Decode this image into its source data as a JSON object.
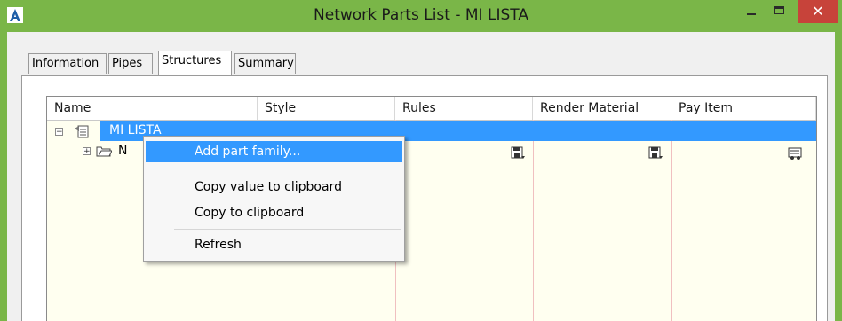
{
  "window": {
    "title": "Network Parts List - MI LISTA",
    "close_label": "✕"
  },
  "tabs": [
    {
      "label": "Information"
    },
    {
      "label": "Pipes"
    },
    {
      "label": "Structures",
      "active": true
    },
    {
      "label": "Summary"
    }
  ],
  "grid": {
    "columns": [
      "Name",
      "Style",
      "Rules",
      "Render Material",
      "Pay Item"
    ],
    "rows": [
      {
        "name": "MI LISTA",
        "selected": true
      },
      {
        "name": "N"
      }
    ]
  },
  "context_menu": {
    "items": [
      "Add part family...",
      "Copy value to clipboard",
      "Copy to clipboard",
      "Refresh"
    ],
    "highlighted": "Add part family..."
  },
  "colors": {
    "title_bar": "#7ab648",
    "close": "#c7433a",
    "selection": "#3399ff",
    "grid_bg": "#fffff0"
  }
}
